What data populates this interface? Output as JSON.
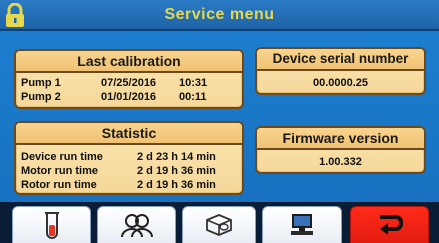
{
  "header": {
    "title": "Service menu",
    "lock_icon": "lock-icon"
  },
  "last_calibration": {
    "title": "Last calibration",
    "rows": [
      {
        "label": "Pump 1",
        "date": "07/25/2016",
        "time": "10:31"
      },
      {
        "label": "Pump 2",
        "date": "01/01/2016",
        "time": "00:11"
      }
    ]
  },
  "device_serial": {
    "title": "Device serial number",
    "value": "00.0000.25"
  },
  "statistic": {
    "title": "Statistic",
    "rows": [
      {
        "label": "Device run time",
        "value": "2 d 23 h 14 min"
      },
      {
        "label": "Motor run time",
        "value": "2 d 19 h 36 min"
      },
      {
        "label": "Rotor run time",
        "value": "2 d 19 h 36 min"
      }
    ]
  },
  "firmware": {
    "title": "Firmware version",
    "value": "1.00.332"
  },
  "footer_tabs": [
    {
      "icon": "test-tube-icon"
    },
    {
      "icon": "users-icon"
    },
    {
      "icon": "device-icon"
    },
    {
      "icon": "computer-icon"
    },
    {
      "icon": "return-arrow-icon"
    }
  ],
  "colors": {
    "background": "#1a78c8",
    "title_text": "#e6d84a",
    "panel_fill": "#f5d79a",
    "panel_border": "#6b4a1e",
    "back_button": "#e21d10"
  }
}
